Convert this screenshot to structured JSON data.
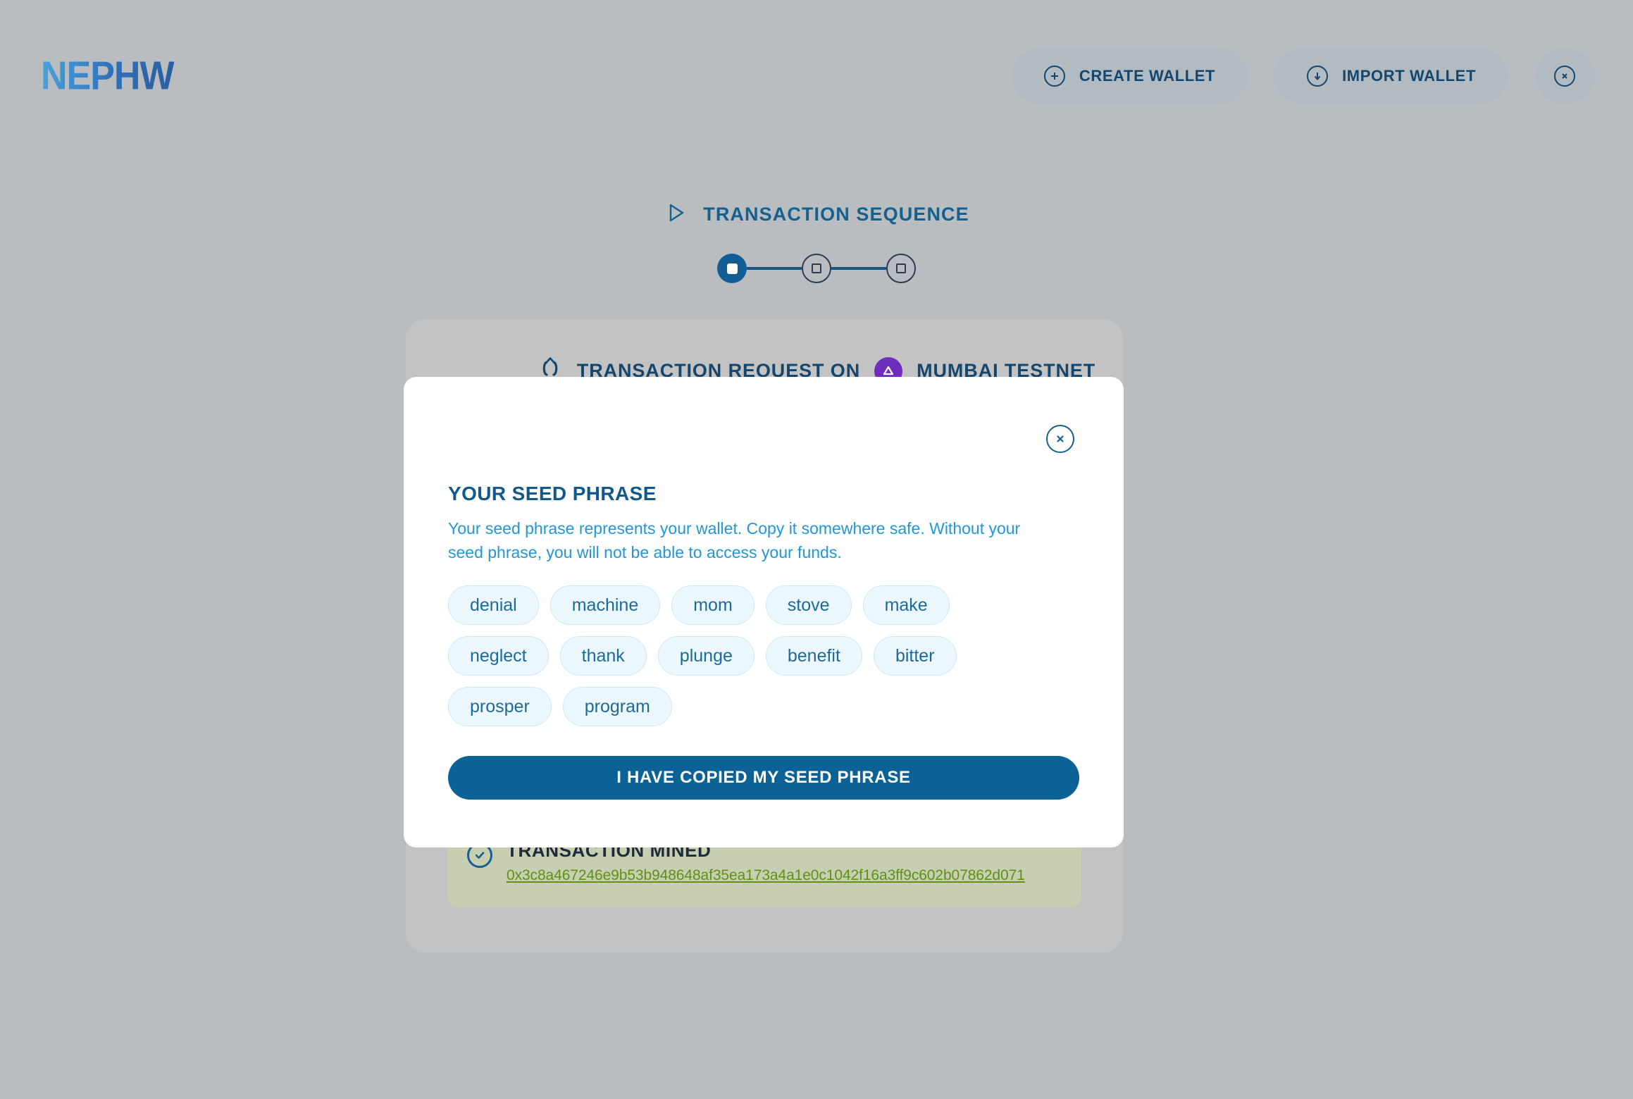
{
  "header": {
    "logo_text": "NEPHW",
    "buttons": [
      {
        "label": "CREATE WALLET",
        "icon": "plus-circle-icon"
      },
      {
        "label": "IMPORT WALLET",
        "icon": "download-circle-icon"
      }
    ],
    "close_button_icon": "close-circle-icon"
  },
  "sequence": {
    "title": "TRANSACTION SEQUENCE",
    "play_icon": "play-triangle-icon",
    "steps": [
      {
        "state": "active"
      },
      {
        "state": "idle"
      },
      {
        "state": "idle"
      }
    ]
  },
  "card": {
    "heading_prefix": "TRANSACTION REQUEST ON",
    "network": "MUMBAI TESTNET",
    "network_icon": "polygon-logo-icon",
    "request_icon": "contract-icon",
    "status": {
      "label": "TRANSACTION MINED",
      "icon": "check-circle-icon",
      "tx_hash": "0x3c8a467246e9b53b948648af35ea173a4a1e0c1042f16a3ff9c602b07862d071"
    }
  },
  "modal": {
    "close_icon": "close-circle-icon",
    "title": "YOUR SEED PHRASE",
    "description": "Your seed phrase represents your wallet. Copy it somewhere safe. Without your seed phrase, you will not be able to access your funds.",
    "seed_words": [
      "denial",
      "machine",
      "mom",
      "stove",
      "make",
      "neglect",
      "thank",
      "plunge",
      "benefit",
      "bitter",
      "prosper",
      "program"
    ],
    "confirm_label": "I HAVE COPIED MY SEED PHRASE"
  },
  "colors": {
    "page_background": "#b9bdc0",
    "card_background": "#c4c3c3",
    "modal_background": "#ffffff",
    "primary_blue": "#0a6297",
    "title_blue": "#13588a",
    "desc_blue": "#2196d9",
    "chip_fill": "#ecf7fd",
    "chip_border": "#cbe8f6",
    "status_box": "#c7ceb1",
    "hash_green": "#5e9215",
    "polygon_purple": "#6f2dbd"
  }
}
